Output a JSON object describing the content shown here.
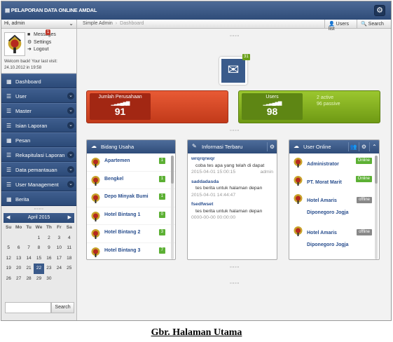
{
  "topbar": {
    "logo": "▤ PELAPORAN DATA ONLINE AMDAL",
    "gear_icon": "gear-icon"
  },
  "sidebar": {
    "hi": "Hi, admin",
    "links": {
      "messages": "Messages",
      "messages_count": "1",
      "settings": "Settings",
      "logout": "Logout"
    },
    "welcome": "Welcom back! Your last visit: 24.10.2012 in 19:58",
    "menu": [
      {
        "label": "Dashboard",
        "icon": "grid-icon",
        "chevron": false
      },
      {
        "label": "User",
        "icon": "list-icon",
        "chevron": true
      },
      {
        "label": "Master",
        "icon": "list-icon",
        "chevron": true
      },
      {
        "label": "Isian Laporan",
        "icon": "list-icon",
        "chevron": true
      },
      {
        "label": "Pesan",
        "icon": "grid-icon",
        "chevron": false
      },
      {
        "label": "Rekapitulasi Laporan",
        "icon": "list-icon",
        "chevron": true
      },
      {
        "label": "Data pemantauan",
        "icon": "list-icon",
        "chevron": true
      },
      {
        "label": "User Management",
        "icon": "list-icon",
        "chevron": true
      },
      {
        "label": "Berita",
        "icon": "grid-icon",
        "chevron": false
      }
    ],
    "calendar": {
      "month": "April 2015",
      "days": [
        "Su",
        "Mo",
        "Tu",
        "We",
        "Th",
        "Fr",
        "Sa"
      ],
      "cells": [
        "",
        "",
        "",
        "1",
        "2",
        "3",
        "4",
        "5",
        "6",
        "7",
        "8",
        "9",
        "10",
        "11",
        "12",
        "13",
        "14",
        "15",
        "16",
        "17",
        "18",
        "19",
        "20",
        "21",
        "22",
        "23",
        "24",
        "25",
        "26",
        "27",
        "28",
        "29",
        "30",
        "",
        ""
      ],
      "today": "22"
    },
    "search_button": "Search"
  },
  "breadcrumb": {
    "root": "Simple Admin",
    "current": "Dashboard",
    "users_list": "Users list",
    "search": "Search"
  },
  "notifications": {
    "count": "31"
  },
  "stats": {
    "perusahaan": {
      "label": "Jumlah Perusahaan",
      "value": "91"
    },
    "users": {
      "label": "Users",
      "value": "98",
      "active": "2 active",
      "passive": "96 passive"
    }
  },
  "bidang_usaha": {
    "title": "Bidang Usaha",
    "rows": [
      {
        "name": "Apartemen",
        "count": "1"
      },
      {
        "name": "Bengkel",
        "count": "1"
      },
      {
        "name": "Depo Minyak Bumi",
        "count": "1"
      },
      {
        "name": "Hotel Bintang 1",
        "count": "0"
      },
      {
        "name": "Hotel Bintang 2",
        "count": "3"
      },
      {
        "name": "Hotel Bintang 3",
        "count": "7"
      }
    ]
  },
  "informasi": {
    "title": "Informasi Terbaru",
    "items": [
      {
        "title": "wrqrqrwqr",
        "desc": "coba tes apa yang telah di dapat",
        "date": "2015-04-01 15:00:15",
        "author": "admin"
      },
      {
        "title": "saddadasda",
        "desc": "tes berita untuk halaman depan",
        "date": "2015-04-01 14:44:47",
        "author": ""
      },
      {
        "title": "fsedfwset",
        "desc": "tes berita untuk halaman depan",
        "date": "0000-00-00 00:00:00",
        "author": ""
      }
    ]
  },
  "user_online": {
    "title": "User Online",
    "rows": [
      {
        "name": "Administrator",
        "status": "Online"
      },
      {
        "name": "PT. Morat Marit",
        "status": "Online"
      },
      {
        "name": "Hotel Amaris Diponegoro Jogja",
        "status": "offline"
      },
      {
        "name": "Hotel Amaris Diponegoro Jogja",
        "status": "offline"
      }
    ]
  },
  "caption": "Gbr. Halaman Utama"
}
